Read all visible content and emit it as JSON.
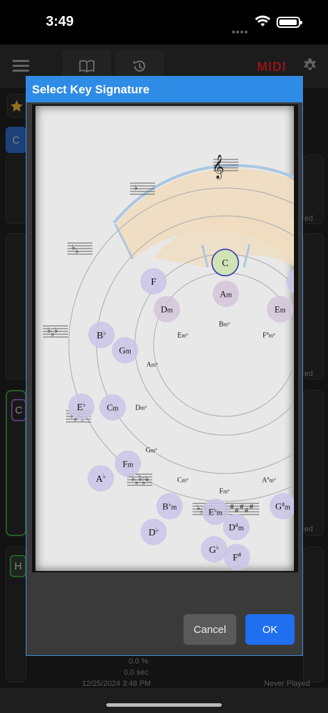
{
  "status": {
    "time": "3:49"
  },
  "appbar": {
    "midi_label": "MIDI"
  },
  "background": {
    "chip_c1": "C",
    "chip_c2": "C",
    "chip_h": "H",
    "edited_1": "ed",
    "edited_2": "ed",
    "edited_3": "ed",
    "percent": "0.0 %",
    "seconds": "0.0 sec",
    "date": "12/25/2024 3:48 PM",
    "never_played": "Never Played"
  },
  "dialog": {
    "title": "Select Key Signature",
    "cancel_label": "Cancel",
    "ok_label": "OK",
    "selected_key": "C",
    "colors": {
      "accent": "#2f8ce6",
      "ok": "#1f6ff0",
      "selected_fill": "#cfe3b6",
      "selected_ring": "#2a2ab0",
      "major_fill": "#c9c4e6",
      "highlight_band": "#efdcc0"
    }
  },
  "circle": {
    "major": [
      {
        "main": "C",
        "acc": "",
        "sel": true
      },
      {
        "main": "F",
        "acc": ""
      },
      {
        "main": "B",
        "acc": "♭"
      },
      {
        "main": "E",
        "acc": "♭"
      },
      {
        "main": "A",
        "acc": "♭"
      },
      {
        "main": "D",
        "acc": "♭"
      },
      {
        "main": "G",
        "acc": "♭"
      },
      {
        "main": "F",
        "acc": "#"
      },
      {
        "main": "G",
        "acc": ""
      }
    ],
    "minor": [
      {
        "main": "A",
        "acc": "",
        "suffix": "m"
      },
      {
        "main": "D",
        "acc": "",
        "suffix": "m"
      },
      {
        "main": "G",
        "acc": "",
        "suffix": "m"
      },
      {
        "main": "C",
        "acc": "",
        "suffix": "m"
      },
      {
        "main": "F",
        "acc": "",
        "suffix": "m"
      },
      {
        "main": "B",
        "acc": "♭",
        "suffix": "m"
      },
      {
        "main": "E",
        "acc": "♭",
        "suffix": "m"
      },
      {
        "main": "D",
        "acc": "#",
        "suffix": "m"
      },
      {
        "main": "G",
        "acc": "#",
        "suffix": "m"
      },
      {
        "main": "E",
        "acc": "",
        "suffix": "m"
      }
    ],
    "diminished": [
      {
        "main": "B",
        "acc": "",
        "suffix": "m°"
      },
      {
        "main": "E",
        "acc": "",
        "suffix": "m°"
      },
      {
        "main": "A",
        "acc": "",
        "suffix": "m°"
      },
      {
        "main": "D",
        "acc": "",
        "suffix": "m°"
      },
      {
        "main": "G",
        "acc": "",
        "suffix": "m°"
      },
      {
        "main": "C",
        "acc": "",
        "suffix": "m°"
      },
      {
        "main": "F",
        "acc": "",
        "suffix": "m°"
      },
      {
        "main": "A",
        "acc": "#",
        "suffix": "m°"
      },
      {
        "main": "F",
        "acc": "#",
        "suffix": "m°"
      }
    ]
  }
}
